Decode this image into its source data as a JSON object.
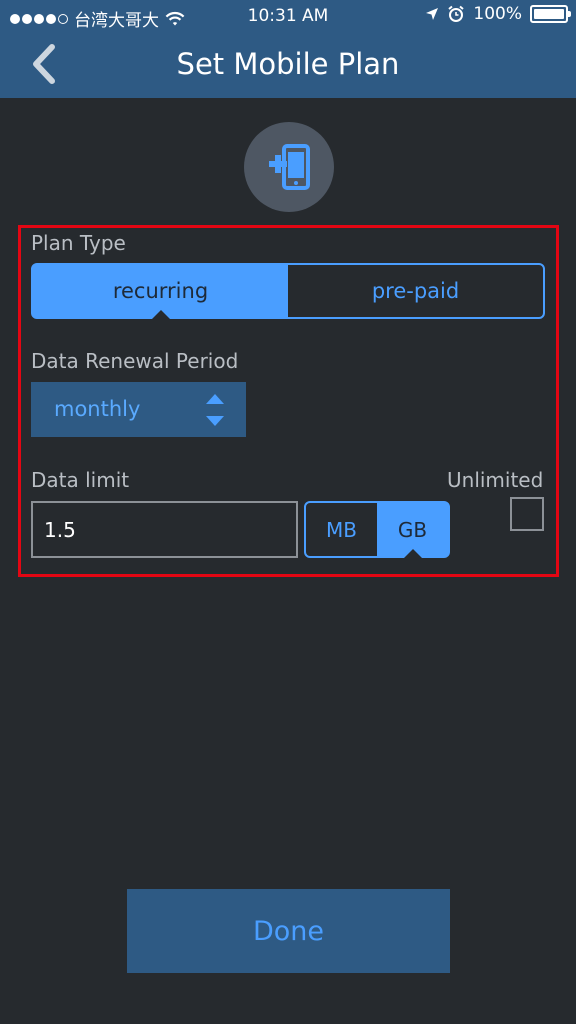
{
  "status_bar": {
    "carrier": "台湾大哥大",
    "time": "10:31 AM",
    "battery": "100%",
    "signal_filled": 4,
    "signal_total": 5
  },
  "header": {
    "title": "Set Mobile Plan",
    "back_icon": "chevron-left-icon"
  },
  "plan_icon": "add-mobile-icon",
  "plan_type": {
    "label": "Plan Type",
    "options": [
      "recurring",
      "pre-paid"
    ],
    "selected": "recurring"
  },
  "renewal": {
    "label": "Data Renewal Period",
    "value": "monthly"
  },
  "data_limit": {
    "label": "Data limit",
    "value": "1.5",
    "units": [
      "MB",
      "GB"
    ],
    "selected_unit": "GB",
    "unlimited_label": "Unlimited",
    "unlimited_checked": false
  },
  "done_label": "Done",
  "colors": {
    "header_bg": "#2e5a84",
    "page_bg": "#262a2e",
    "accent": "#4a9eff",
    "annotation_box": "#e30613"
  }
}
